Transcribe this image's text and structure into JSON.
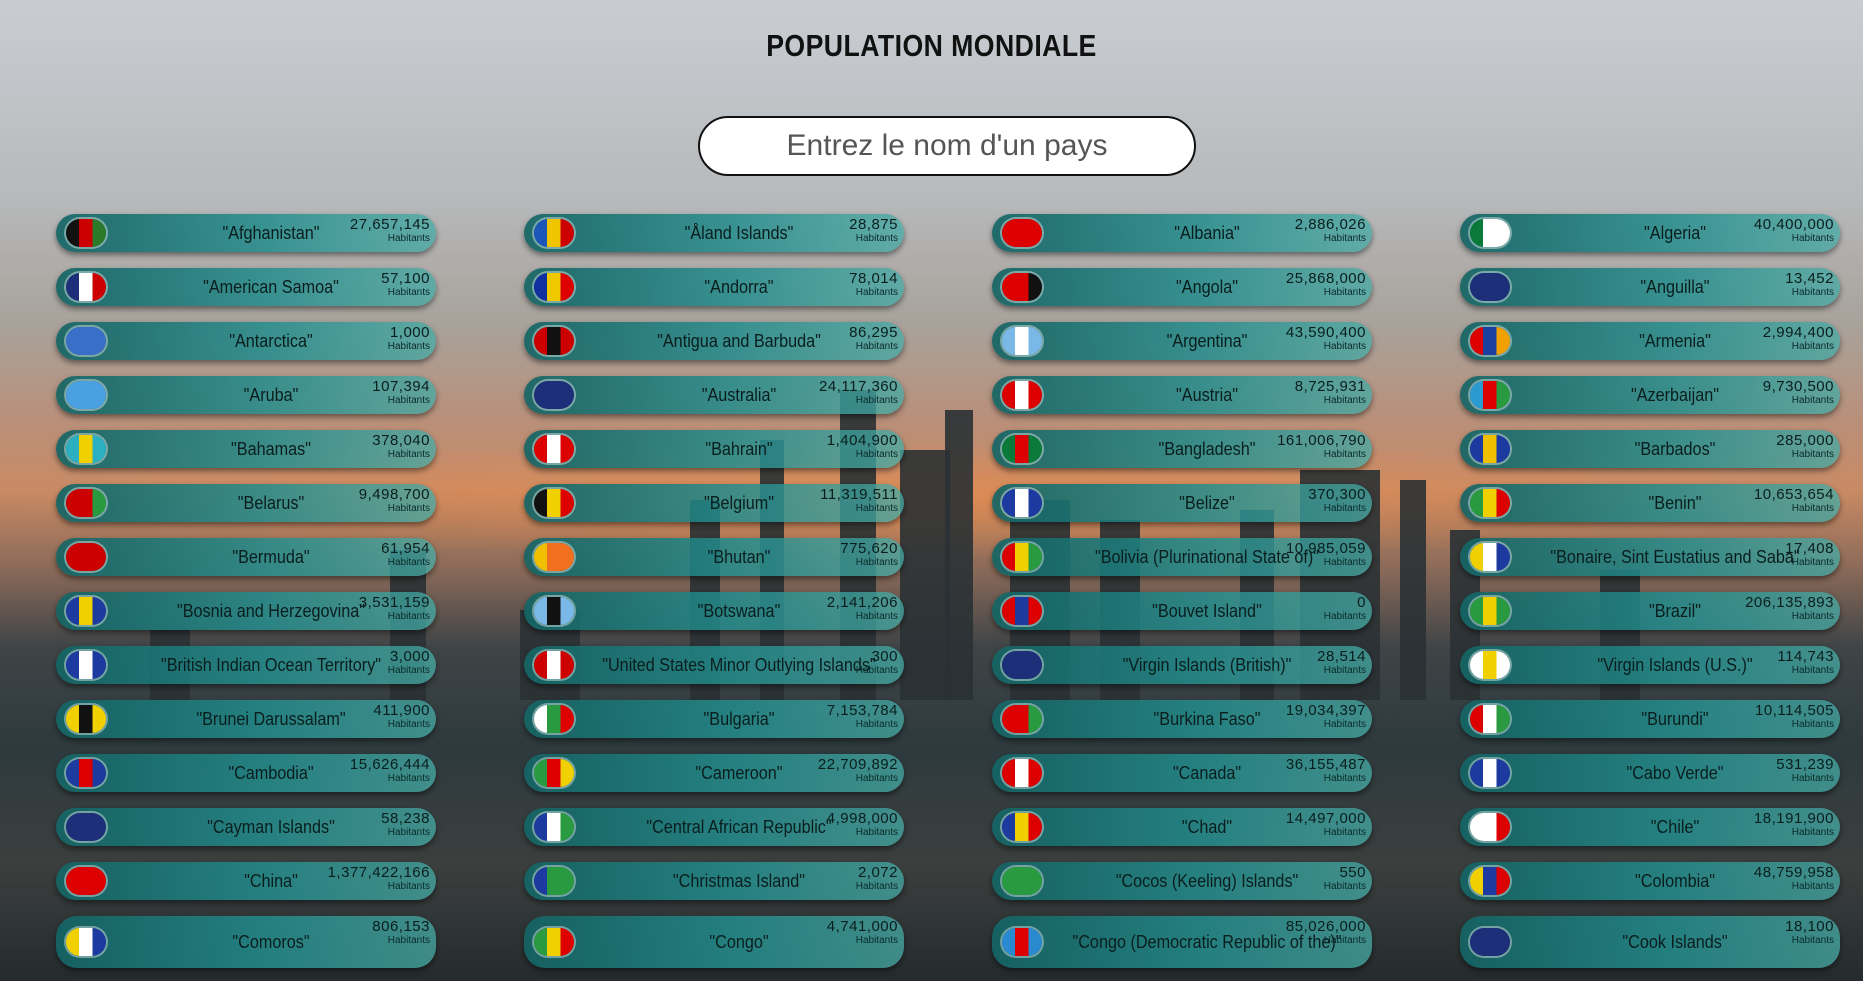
{
  "page": {
    "title": "POPULATION MONDIALE",
    "search_placeholder": "Entrez le nom d'un pays"
  },
  "unit_label": "Habitants",
  "countries": [
    {
      "name": "\"Afghanistan\"",
      "population": "27,657,145",
      "flag": [
        "#111",
        "#c00",
        "#2a7a2a"
      ]
    },
    {
      "name": "\"Åland Islands\"",
      "population": "28,875",
      "flag": [
        "#1c57b8",
        "#f0c400",
        "#c00"
      ]
    },
    {
      "name": "\"Albania\"",
      "population": "2,886,026",
      "flag": [
        "#d00",
        "#d00",
        "#d00"
      ]
    },
    {
      "name": "\"Algeria\"",
      "population": "40,400,000",
      "flag": [
        "#0a7a3a",
        "#fff",
        "#fff"
      ]
    },
    {
      "name": "\"American Samoa\"",
      "population": "57,100",
      "flag": [
        "#1c2f78",
        "#fff",
        "#c00"
      ]
    },
    {
      "name": "\"Andorra\"",
      "population": "78,014",
      "flag": [
        "#1030a0",
        "#f0c800",
        "#d00"
      ]
    },
    {
      "name": "\"Angola\"",
      "population": "25,868,000",
      "flag": [
        "#d00",
        "#d00",
        "#111"
      ]
    },
    {
      "name": "\"Anguilla\"",
      "population": "13,452",
      "flag": [
        "#1c2f78",
        "#1c2f78",
        "#1c2f78"
      ]
    },
    {
      "name": "\"Antarctica\"",
      "population": "1,000",
      "flag": [
        "#3a6fc8",
        "#3a6fc8",
        "#3a6fc8"
      ]
    },
    {
      "name": "\"Antigua and Barbuda\"",
      "population": "86,295",
      "flag": [
        "#c00",
        "#111",
        "#c00"
      ]
    },
    {
      "name": "\"Argentina\"",
      "population": "43,590,400",
      "flag": [
        "#7ab8e8",
        "#fff",
        "#7ab8e8"
      ]
    },
    {
      "name": "\"Armenia\"",
      "population": "2,994,400",
      "flag": [
        "#d00",
        "#1c40a0",
        "#f0a000"
      ]
    },
    {
      "name": "\"Aruba\"",
      "population": "107,394",
      "flag": [
        "#4aa0e0",
        "#4aa0e0",
        "#4aa0e0"
      ]
    },
    {
      "name": "\"Australia\"",
      "population": "24,117,360",
      "flag": [
        "#1c2f78",
        "#1c2f78",
        "#1c2f78"
      ]
    },
    {
      "name": "\"Austria\"",
      "population": "8,725,931",
      "flag": [
        "#d00",
        "#fff",
        "#d00"
      ]
    },
    {
      "name": "\"Azerbaijan\"",
      "population": "9,730,500",
      "flag": [
        "#2a9ad0",
        "#d00",
        "#2a9a40"
      ]
    },
    {
      "name": "\"Bahamas\"",
      "population": "378,040",
      "flag": [
        "#2ab0c0",
        "#f0d000",
        "#2ab0c0"
      ]
    },
    {
      "name": "\"Bahrain\"",
      "population": "1,404,900",
      "flag": [
        "#d00",
        "#fff",
        "#d00"
      ]
    },
    {
      "name": "\"Bangladesh\"",
      "population": "161,006,790",
      "flag": [
        "#0a7a3a",
        "#d00",
        "#0a7a3a"
      ]
    },
    {
      "name": "\"Barbados\"",
      "population": "285,000",
      "flag": [
        "#1c3aa0",
        "#f0c000",
        "#1c3aa0"
      ]
    },
    {
      "name": "\"Belarus\"",
      "population": "9,498,700",
      "flag": [
        "#c00",
        "#c00",
        "#2a9a40"
      ]
    },
    {
      "name": "\"Belgium\"",
      "population": "11,319,511",
      "flag": [
        "#111",
        "#f0d000",
        "#d00"
      ]
    },
    {
      "name": "\"Belize\"",
      "population": "370,300",
      "flag": [
        "#1c3aa0",
        "#fff",
        "#1c3aa0"
      ]
    },
    {
      "name": "\"Benin\"",
      "population": "10,653,654",
      "flag": [
        "#2a9a40",
        "#f0d000",
        "#d00"
      ]
    },
    {
      "name": "\"Bermuda\"",
      "population": "61,954",
      "flag": [
        "#c00",
        "#c00",
        "#c00"
      ]
    },
    {
      "name": "\"Bhutan\"",
      "population": "775,620",
      "flag": [
        "#f0c000",
        "#f07020",
        "#f07020"
      ]
    },
    {
      "name": "\"Bolivia (Plurinational State of)\"",
      "population": "10,985,059",
      "flag": [
        "#d00",
        "#f0d000",
        "#2a9a40"
      ]
    },
    {
      "name": "\"Bonaire, Sint Eustatius and Saba\"",
      "population": "17,408",
      "flag": [
        "#f0d000",
        "#fff",
        "#1c3aa0"
      ]
    },
    {
      "name": "\"Bosnia and Herzegovina\"",
      "population": "3,531,159",
      "flag": [
        "#1c3aa0",
        "#f0d000",
        "#1c3aa0"
      ]
    },
    {
      "name": "\"Botswana\"",
      "population": "2,141,206",
      "flag": [
        "#7ab8e8",
        "#111",
        "#7ab8e8"
      ]
    },
    {
      "name": "\"Bouvet Island\"",
      "population": "0",
      "flag": [
        "#d00",
        "#1c3aa0",
        "#d00"
      ]
    },
    {
      "name": "\"Brazil\"",
      "population": "206,135,893",
      "flag": [
        "#2a9a40",
        "#f0d000",
        "#2a9a40"
      ]
    },
    {
      "name": "\"British Indian Ocean Territory\"",
      "population": "3,000",
      "flag": [
        "#1c3aa0",
        "#fff",
        "#1c3aa0"
      ]
    },
    {
      "name": "\"United States Minor Outlying Islands\"",
      "population": "300",
      "flag": [
        "#c00",
        "#fff",
        "#c00"
      ]
    },
    {
      "name": "\"Virgin Islands (British)\"",
      "population": "28,514",
      "flag": [
        "#1c2f78",
        "#1c2f78",
        "#1c2f78"
      ]
    },
    {
      "name": "\"Virgin Islands (U.S.)\"",
      "population": "114,743",
      "flag": [
        "#fff",
        "#f0d000",
        "#fff"
      ]
    },
    {
      "name": "\"Brunei Darussalam\"",
      "population": "411,900",
      "flag": [
        "#f0d000",
        "#111",
        "#f0d000"
      ]
    },
    {
      "name": "\"Bulgaria\"",
      "population": "7,153,784",
      "flag": [
        "#fff",
        "#2a9a40",
        "#d00"
      ]
    },
    {
      "name": "\"Burkina Faso\"",
      "population": "19,034,397",
      "flag": [
        "#d00",
        "#d00",
        "#2a9a40"
      ]
    },
    {
      "name": "\"Burundi\"",
      "population": "10,114,505",
      "flag": [
        "#d00",
        "#fff",
        "#2a9a40"
      ]
    },
    {
      "name": "\"Cambodia\"",
      "population": "15,626,444",
      "flag": [
        "#1c3aa0",
        "#d00",
        "#1c3aa0"
      ]
    },
    {
      "name": "\"Cameroon\"",
      "population": "22,709,892",
      "flag": [
        "#2a9a40",
        "#d00",
        "#f0d000"
      ]
    },
    {
      "name": "\"Canada\"",
      "population": "36,155,487",
      "flag": [
        "#d00",
        "#fff",
        "#d00"
      ]
    },
    {
      "name": "\"Cabo Verde\"",
      "population": "531,239",
      "flag": [
        "#1c3aa0",
        "#fff",
        "#1c3aa0"
      ]
    },
    {
      "name": "\"Cayman Islands\"",
      "population": "58,238",
      "flag": [
        "#1c2f78",
        "#1c2f78",
        "#1c2f78"
      ]
    },
    {
      "name": "\"Central African Republic\"",
      "population": "4,998,000",
      "flag": [
        "#1c3aa0",
        "#fff",
        "#2a9a40"
      ]
    },
    {
      "name": "\"Chad\"",
      "population": "14,497,000",
      "flag": [
        "#1c3aa0",
        "#f0d000",
        "#d00"
      ]
    },
    {
      "name": "\"Chile\"",
      "population": "18,191,900",
      "flag": [
        "#fff",
        "#fff",
        "#d00"
      ]
    },
    {
      "name": "\"China\"",
      "population": "1,377,422,166",
      "flag": [
        "#d00",
        "#d00",
        "#d00"
      ]
    },
    {
      "name": "\"Christmas Island\"",
      "population": "2,072",
      "flag": [
        "#1c3aa0",
        "#2a9a40",
        "#2a9a40"
      ]
    },
    {
      "name": "\"Cocos (Keeling) Islands\"",
      "population": "550",
      "flag": [
        "#2a9a40",
        "#2a9a40",
        "#2a9a40"
      ]
    },
    {
      "name": "\"Colombia\"",
      "population": "48,759,958",
      "flag": [
        "#f0d000",
        "#1c3aa0",
        "#d00"
      ]
    },
    {
      "name": "\"Comoros\"",
      "population": "806,153",
      "flag": [
        "#f0d000",
        "#fff",
        "#1c3aa0"
      ]
    },
    {
      "name": "\"Congo\"",
      "population": "4,741,000",
      "flag": [
        "#2a9a40",
        "#f0d000",
        "#d00"
      ]
    },
    {
      "name": "\"Congo (Democratic Republic of the)\"",
      "population": "85,026,000",
      "flag": [
        "#2a8ad0",
        "#d00",
        "#2a8ad0"
      ]
    },
    {
      "name": "\"Cook Islands\"",
      "population": "18,100",
      "flag": [
        "#1c2f78",
        "#1c2f78",
        "#1c2f78"
      ]
    }
  ]
}
